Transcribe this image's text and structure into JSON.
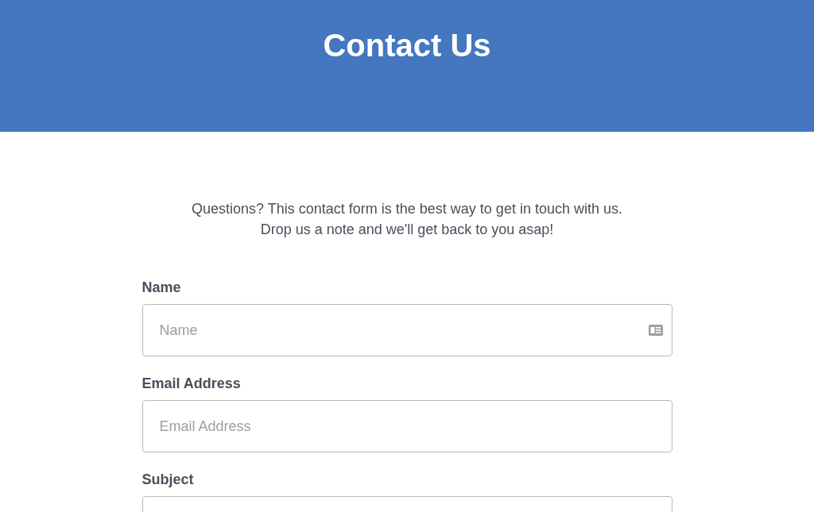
{
  "header": {
    "title": "Contact Us"
  },
  "intro": [
    "Questions? This contact form is the best way to get in touch with us.",
    "Drop us a note and we'll get back to you asap!"
  ],
  "fields": [
    {
      "label": "Name",
      "placeholder": "Name",
      "kind": "name"
    },
    {
      "label": "Email Address",
      "placeholder": "Email Address",
      "kind": "email"
    },
    {
      "label": "Subject",
      "kind": "text"
    }
  ]
}
